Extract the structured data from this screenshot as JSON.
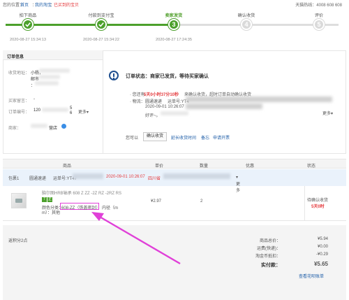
{
  "breadcrumb": {
    "prefix": "您的位置：",
    "home": "首页",
    "sep": "：",
    "mine": "我的淘宝",
    "sep2": "：",
    "current": "已买到的宝贝",
    "hotline": "天猫热线：4008 608 608"
  },
  "progress": {
    "steps": [
      {
        "label": "拍下商品",
        "number": "1",
        "time": "2020-08-27 15:34:13",
        "state": "done"
      },
      {
        "label": "付款到支付宝",
        "number": "2",
        "time": "2020-08-27 15:34:22",
        "state": "done"
      },
      {
        "label": "卖家发货",
        "number": "3",
        "time": "2020-08-27 17:24:35",
        "state": "current"
      },
      {
        "label": "确认收货",
        "number": "4",
        "time": "",
        "state": "todo"
      },
      {
        "label": "评价",
        "number": "5",
        "time": "",
        "state": "todo"
      }
    ],
    "colors": {
      "done": "#4ca02c",
      "todo": "#dadada"
    }
  },
  "order_info": {
    "title": "订单信息",
    "address_label": "收货地址：",
    "address_line1": "小杨，",
    "address_line2": "邮市",
    "address_line3": "：",
    "buyer_msg_label": "买家留言：",
    "buyer_msg_value": "-",
    "order_no_label": "订单编号：",
    "order_no_value": "120",
    "order_no_tail": "5",
    "order_no_tail2": "6",
    "more": "更多",
    "merchant_label": "商家：",
    "merchant_value": "营店"
  },
  "status": {
    "title": "订单状态：商家已发货，等待买家确认",
    "remaining_prefix": "· 您还有",
    "remaining_time": "5天0小时37分10秒",
    "remaining_suffix": "来确认收货，超时订单自动确认收货",
    "logistics_label": "· 物流：",
    "logistics_company": "圆通速递",
    "waybill_prefix": "运单号:YT4",
    "logistics_time": "2020-09-01 10:26:07",
    "logistics_more": "更多",
    "logistics_extra": "好评~。",
    "you_can": "您可以",
    "confirm_button": "确认收货",
    "extend_link": "延长收货时间",
    "remark_link": "备忘",
    "invoice_link": "申请开票"
  },
  "table": {
    "headers": [
      "商品",
      "单价",
      "数量",
      "优惠",
      "状态"
    ],
    "package": {
      "label": "包裹1",
      "company": "圆通速递",
      "waybill": "运单号:YT47",
      "time": "2020-09-01 10:26:07",
      "place": "四川省",
      "more": "更多"
    },
    "item": {
      "title": "脑尔图HRB轴承 608 Z ZZ -2Z RZ -2RZ RS",
      "tag1": "7",
      "tag2": "正",
      "spec_label": "颜色分类：",
      "spec_value": "608-ZZ（铁盖密封）",
      "spec_more": "内径（m",
      "spec_more2": "m）：其他",
      "price": "¥2.97",
      "quantity": "2",
      "status": "待确认收货",
      "status_time": "5天0时",
      "tag_colors": {
        "tag1": "#4ca02c",
        "tag2": "#4ca02c"
      }
    }
  },
  "summary": {
    "points": "返积分2点",
    "goods_total_label": "商品总价：",
    "goods_total": "¥5.94",
    "shipping_label": "运费(快递)：",
    "shipping": "¥0.00",
    "coin_label": "淘金币抵扣：",
    "coin": "-¥0.29",
    "paid_label": "实付款：",
    "paid": "¥5.65",
    "bill_link": "查看花呗账单"
  },
  "accent": {
    "highlight": "#e040d8",
    "link": "#1f5ea8",
    "red": "#e4393c"
  }
}
